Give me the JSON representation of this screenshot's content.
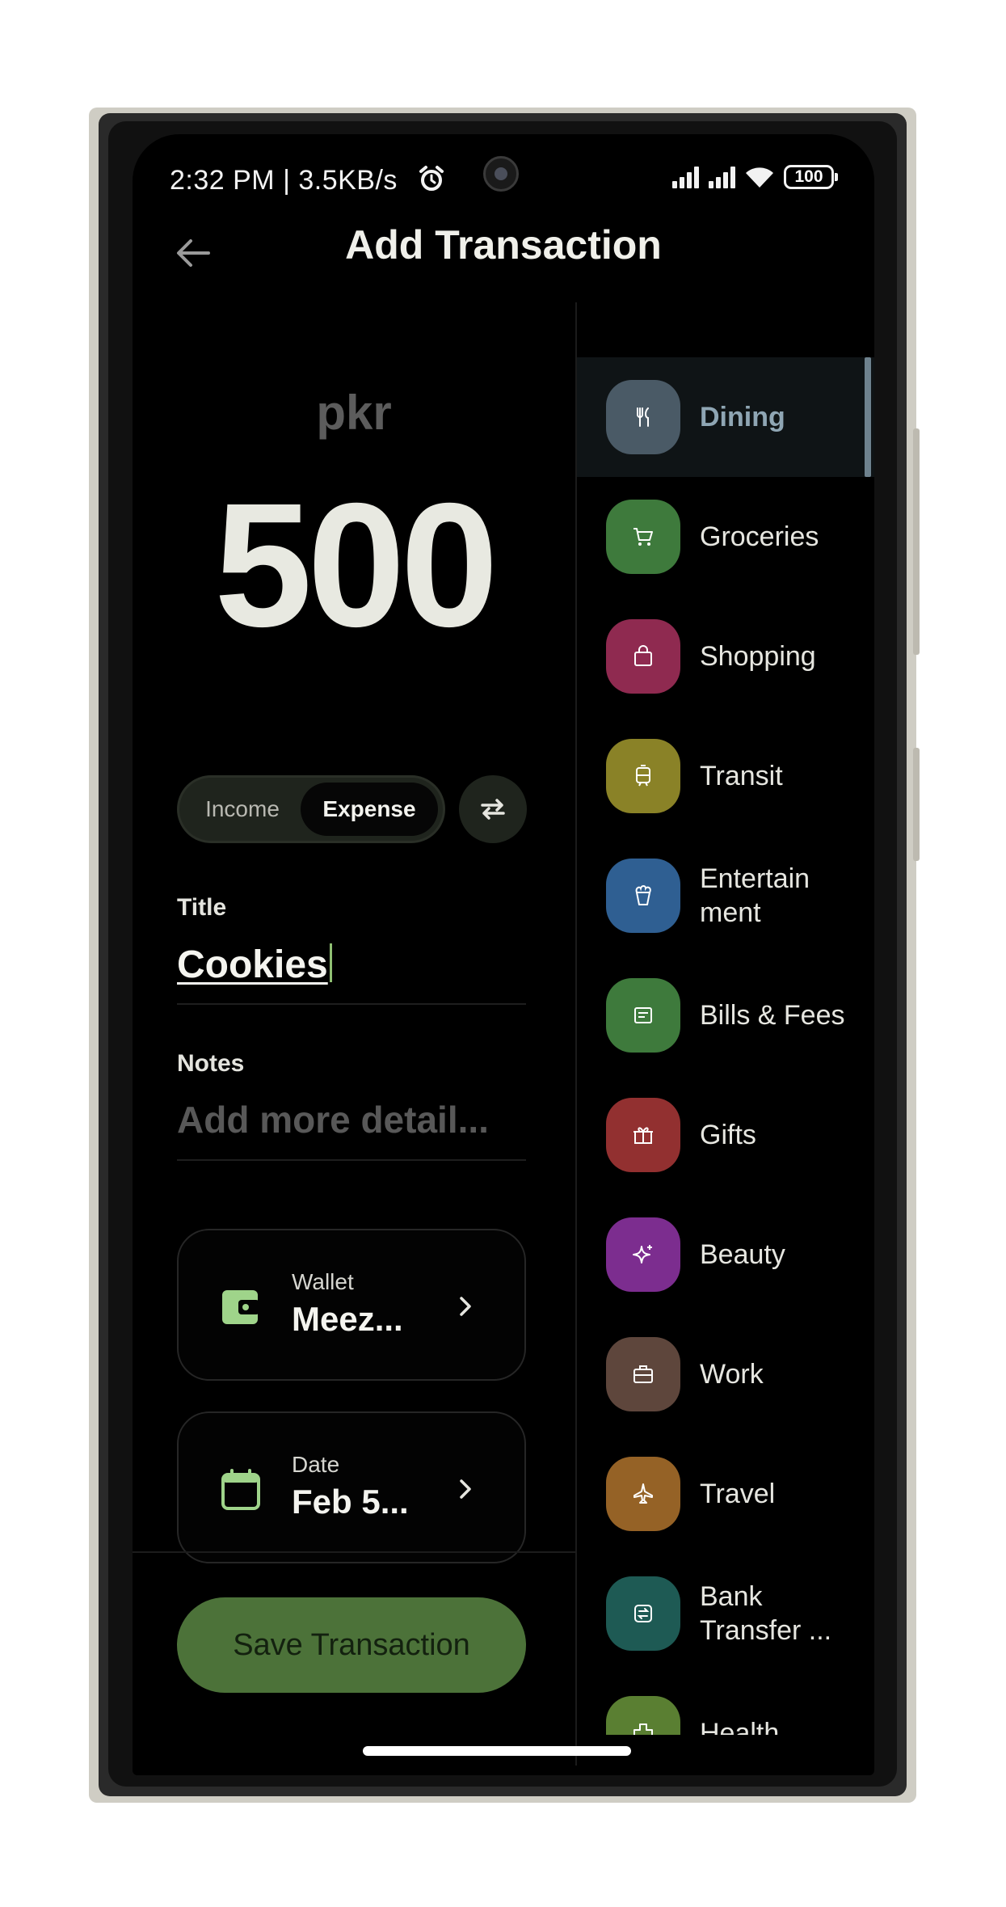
{
  "status_bar": {
    "time": "2:32 PM | 3.5KB/s",
    "battery": "100"
  },
  "header": {
    "title": "Add Transaction"
  },
  "amount": {
    "currency": "pkr",
    "value": "500"
  },
  "type_toggle": {
    "income_label": "Income",
    "expense_label": "Expense",
    "selected": "Expense"
  },
  "form": {
    "title_label": "Title",
    "title_value": "Cookies",
    "notes_label": "Notes",
    "notes_placeholder": "Add more detail..."
  },
  "wallet": {
    "label": "Wallet",
    "value": "Meez..."
  },
  "date": {
    "label": "Date",
    "value": "Feb 5..."
  },
  "save_button": "Save Transaction",
  "categories": [
    {
      "label": "Dining",
      "color": "#4a5a66",
      "icon": "fork-knife-icon",
      "selected": true
    },
    {
      "label": "Groceries",
      "color": "#3e7a3c",
      "icon": "cart-icon"
    },
    {
      "label": "Shopping",
      "color": "#8f2a50",
      "icon": "bag-icon"
    },
    {
      "label": "Transit",
      "color": "#8a8227",
      "icon": "tram-icon"
    },
    {
      "label": "Entertain ment",
      "color": "#2f5f92",
      "icon": "popcorn-icon"
    },
    {
      "label": "Bills & Fees",
      "color": "#3e7a3c",
      "icon": "receipt-icon"
    },
    {
      "label": "Gifts",
      "color": "#923030",
      "icon": "gift-icon"
    },
    {
      "label": "Beauty",
      "color": "#7c2d8f",
      "icon": "sparkle-icon"
    },
    {
      "label": "Work",
      "color": "#5e463c",
      "icon": "briefcase-icon"
    },
    {
      "label": "Travel",
      "color": "#956226",
      "icon": "plane-icon"
    },
    {
      "label": "Bank Transfer ...",
      "color": "#1e5a54",
      "icon": "transfer-icon"
    },
    {
      "label": "Health",
      "color": "#5a7f32",
      "icon": "health-cross-icon"
    }
  ]
}
